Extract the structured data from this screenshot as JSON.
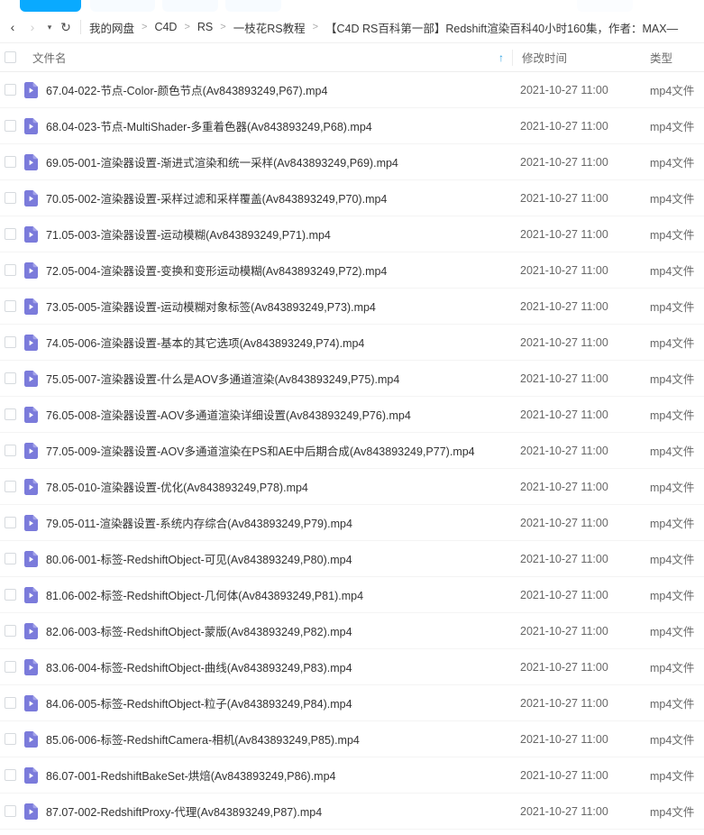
{
  "toolbar": {
    "primary_button_label": "",
    "accent_color": "#09aaff"
  },
  "breadcrumb": {
    "back_icon": "‹",
    "forward_icon": "›",
    "history_caret_icon": "▾",
    "refresh_icon": "↻",
    "separator": ">",
    "items": [
      "我的网盘",
      "C4D",
      "RS",
      "一枝花RS教程",
      "【C4D RS百科第一部】Redshift渲染百科40小时160集，作者：MAX—"
    ]
  },
  "columns": {
    "name": "文件名",
    "modified": "修改时间",
    "type": "类型",
    "sort_icon": "↑",
    "sort_color": "#2a9fe0"
  },
  "files": [
    {
      "name": "67.04-022-节点-Color-颜色节点(Av843893249,P67).mp4",
      "modified": "2021-10-27 11:00",
      "type": "mp4文件"
    },
    {
      "name": "68.04-023-节点-MultiShader-多重着色器(Av843893249,P68).mp4",
      "modified": "2021-10-27 11:00",
      "type": "mp4文件"
    },
    {
      "name": "69.05-001-渲染器设置-渐进式渲染和统一采样(Av843893249,P69).mp4",
      "modified": "2021-10-27 11:00",
      "type": "mp4文件"
    },
    {
      "name": "70.05-002-渲染器设置-采样过滤和采样覆盖(Av843893249,P70).mp4",
      "modified": "2021-10-27 11:00",
      "type": "mp4文件"
    },
    {
      "name": "71.05-003-渲染器设置-运动模糊(Av843893249,P71).mp4",
      "modified": "2021-10-27 11:00",
      "type": "mp4文件"
    },
    {
      "name": "72.05-004-渲染器设置-变换和变形运动模糊(Av843893249,P72).mp4",
      "modified": "2021-10-27 11:00",
      "type": "mp4文件"
    },
    {
      "name": "73.05-005-渲染器设置-运动模糊对象标签(Av843893249,P73).mp4",
      "modified": "2021-10-27 11:00",
      "type": "mp4文件"
    },
    {
      "name": "74.05-006-渲染器设置-基本的其它选项(Av843893249,P74).mp4",
      "modified": "2021-10-27 11:00",
      "type": "mp4文件"
    },
    {
      "name": "75.05-007-渲染器设置-什么是AOV多通道渲染(Av843893249,P75).mp4",
      "modified": "2021-10-27 11:00",
      "type": "mp4文件"
    },
    {
      "name": "76.05-008-渲染器设置-AOV多通道渲染详细设置(Av843893249,P76).mp4",
      "modified": "2021-10-27 11:00",
      "type": "mp4文件"
    },
    {
      "name": "77.05-009-渲染器设置-AOV多通道渲染在PS和AE中后期合成(Av843893249,P77).mp4",
      "modified": "2021-10-27 11:00",
      "type": "mp4文件"
    },
    {
      "name": "78.05-010-渲染器设置-优化(Av843893249,P78).mp4",
      "modified": "2021-10-27 11:00",
      "type": "mp4文件"
    },
    {
      "name": "79.05-011-渲染器设置-系统内存综合(Av843893249,P79).mp4",
      "modified": "2021-10-27 11:00",
      "type": "mp4文件"
    },
    {
      "name": "80.06-001-标签-RedshiftObject-可见(Av843893249,P80).mp4",
      "modified": "2021-10-27 11:00",
      "type": "mp4文件"
    },
    {
      "name": "81.06-002-标签-RedshiftObject-几何体(Av843893249,P81).mp4",
      "modified": "2021-10-27 11:00",
      "type": "mp4文件"
    },
    {
      "name": "82.06-003-标签-RedshiftObject-蒙版(Av843893249,P82).mp4",
      "modified": "2021-10-27 11:00",
      "type": "mp4文件"
    },
    {
      "name": "83.06-004-标签-RedshiftObject-曲线(Av843893249,P83).mp4",
      "modified": "2021-10-27 11:00",
      "type": "mp4文件"
    },
    {
      "name": "84.06-005-标签-RedshiftObject-粒子(Av843893249,P84).mp4",
      "modified": "2021-10-27 11:00",
      "type": "mp4文件"
    },
    {
      "name": "85.06-006-标签-RedshiftCamera-相机(Av843893249,P85).mp4",
      "modified": "2021-10-27 11:00",
      "type": "mp4文件"
    },
    {
      "name": "86.07-001-RedshiftBakeSet-烘焙(Av843893249,P86).mp4",
      "modified": "2021-10-27 11:00",
      "type": "mp4文件"
    },
    {
      "name": "87.07-002-RedshiftProxy-代理(Av843893249,P87).mp4",
      "modified": "2021-10-27 11:00",
      "type": "mp4文件"
    }
  ],
  "file_icon": {
    "name": "video-file-icon",
    "body_color": "#7b7bdb",
    "fold_color": "#a5a5ea",
    "play_color": "#ffffff"
  }
}
